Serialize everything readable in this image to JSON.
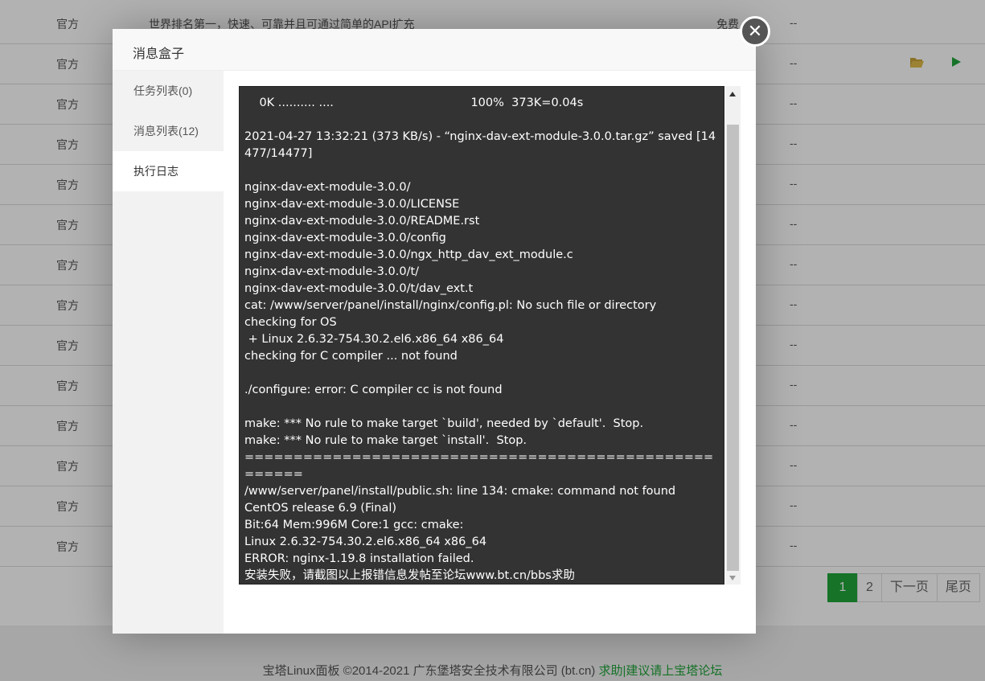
{
  "background": {
    "rows": [
      {
        "type": "官方",
        "desc": "世界排名第一，快速、可靠并且可通过简单的API扩充",
        "price": "免费",
        "status": "--"
      },
      {
        "type": "官方",
        "desc": "",
        "price": "",
        "status": "--"
      },
      {
        "type": "官方",
        "desc": "",
        "price": "",
        "status": "--"
      },
      {
        "type": "官方",
        "desc": "",
        "price": "",
        "status": "--"
      },
      {
        "type": "官方",
        "desc": "",
        "price": "",
        "status": "--"
      },
      {
        "type": "官方",
        "desc": "",
        "price": "",
        "status": "--"
      },
      {
        "type": "官方",
        "desc": "",
        "price": "",
        "status": "--"
      },
      {
        "type": "官方",
        "desc": "",
        "price": "",
        "status": "--"
      },
      {
        "type": "官方",
        "desc": "",
        "price": "",
        "status": "--"
      },
      {
        "type": "官方",
        "desc": "",
        "price": "",
        "status": "--"
      },
      {
        "type": "官方",
        "desc": "",
        "price": "",
        "status": "--"
      },
      {
        "type": "官方",
        "desc": "",
        "price": "",
        "status": "--"
      },
      {
        "type": "官方",
        "desc": "",
        "price": "",
        "status": "--"
      },
      {
        "type": "官方",
        "desc": "",
        "price": "",
        "status": "--"
      }
    ],
    "row2_icons": [
      "folder-icon",
      "play-icon"
    ],
    "pagination": {
      "pages": [
        "1",
        "2"
      ],
      "next": "下一页",
      "last": "尾页",
      "current": "1"
    },
    "footer": {
      "text": "宝塔Linux面板 ©2014-2021 广东堡塔安全技术有限公司 (bt.cn)",
      "link": "求助|建议请上宝塔论坛"
    }
  },
  "modal": {
    "title": "消息盒子",
    "close_icon": "close-icon",
    "sidebar": [
      {
        "label": "任务列表(0)",
        "active": false
      },
      {
        "label": "消息列表(12)",
        "active": false
      },
      {
        "label": "执行日志",
        "active": true
      }
    ],
    "log_lines": [
      "    0K .......... ....                                     100%  373K=0.04s",
      "",
      "2021-04-27 13:32:21 (373 KB/s) - “nginx-dav-ext-module-3.0.0.tar.gz” saved [14477/14477]",
      "",
      "nginx-dav-ext-module-3.0.0/",
      "nginx-dav-ext-module-3.0.0/LICENSE",
      "nginx-dav-ext-module-3.0.0/README.rst",
      "nginx-dav-ext-module-3.0.0/config",
      "nginx-dav-ext-module-3.0.0/ngx_http_dav_ext_module.c",
      "nginx-dav-ext-module-3.0.0/t/",
      "nginx-dav-ext-module-3.0.0/t/dav_ext.t",
      "cat: /www/server/panel/install/nginx/config.pl: No such file or directory",
      "checking for OS",
      " + Linux 2.6.32-754.30.2.el6.x86_64 x86_64",
      "checking for C compiler ... not found",
      "",
      "./configure: error: C compiler cc is not found",
      "",
      "make: *** No rule to make target `build', needed by `default'.  Stop.",
      "make: *** No rule to make target `install'.  Stop.",
      "======================================================",
      "/www/server/panel/install/public.sh: line 134: cmake: command not found",
      "CentOS release 6.9 (Final)",
      "Bit:64 Mem:996M Core:1 gcc: cmake:",
      "Linux 2.6.32-754.30.2.el6.x86_64 x86_64",
      "ERROR: nginx-1.19.8 installation failed.",
      "安装失败，请截图以上报错信息发帖至论坛www.bt.cn/bbs求助"
    ]
  }
}
